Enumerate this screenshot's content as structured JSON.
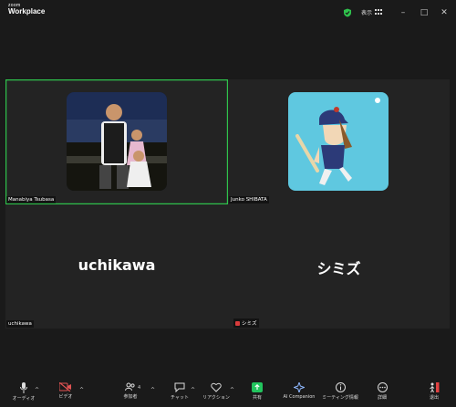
{
  "app": {
    "logo_small": "zoom",
    "logo_big": "Workplace",
    "view_label": "表示",
    "colors": {
      "accent_green": "#2fc24c",
      "share_green": "#22c55e",
      "mute_red": "#d93c3c"
    }
  },
  "participants": [
    {
      "name": "Manabiya Tsubasa",
      "type": "photo",
      "active": true
    },
    {
      "name": "Junko SHIBATA",
      "type": "illustration",
      "active": false
    },
    {
      "name": "uchikawa",
      "display": "uchikawa",
      "type": "name",
      "active": false
    },
    {
      "name": "シミズ",
      "display": "シミズ",
      "type": "name",
      "active": false,
      "muted": true
    }
  ],
  "toolbar": {
    "audio": "オーディオ",
    "video": "ビデオ",
    "participants": "参加者",
    "participants_count": "4",
    "chat": "チャット",
    "reactions": "リアクション",
    "share": "共有",
    "ai": "AI Companion",
    "meeting_info": "ミーティング情報",
    "more": "詳細",
    "leave": "退出"
  }
}
